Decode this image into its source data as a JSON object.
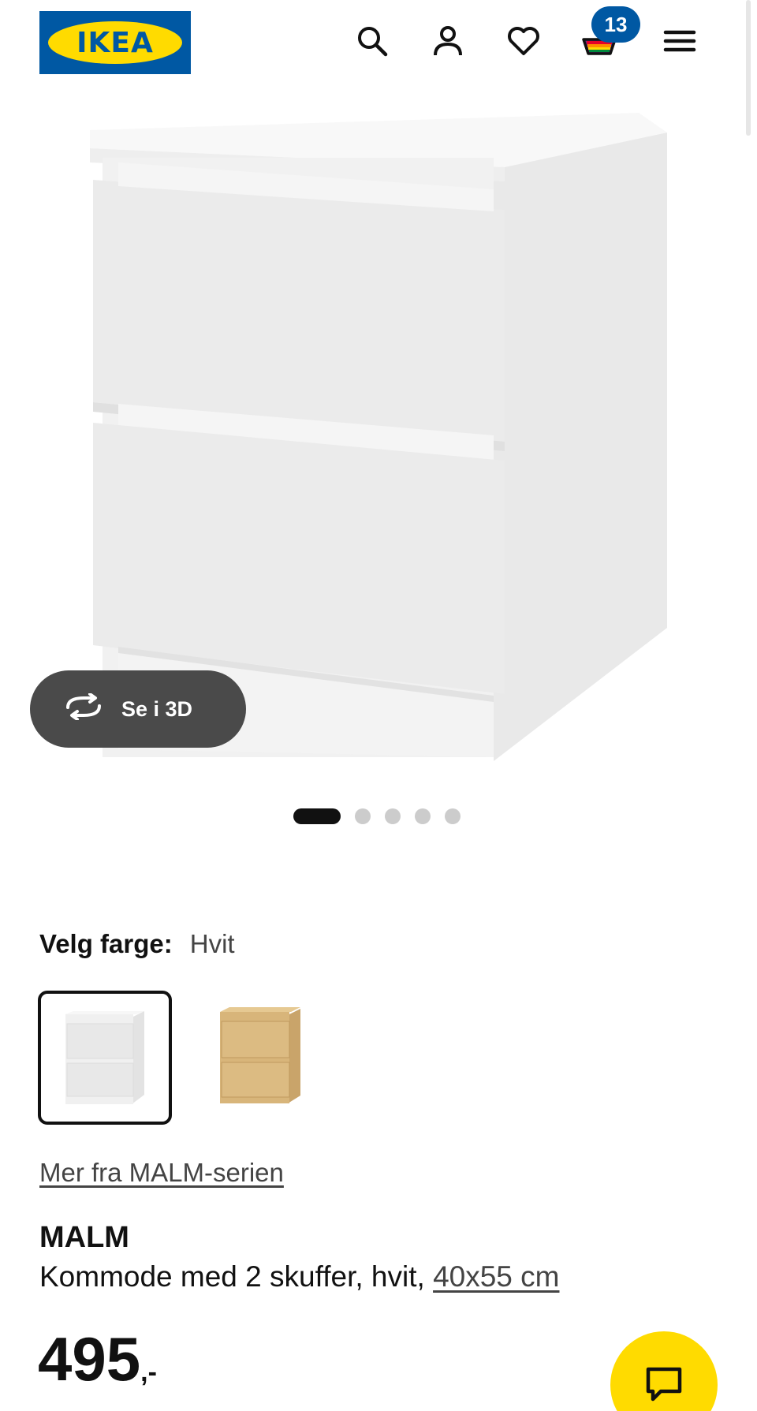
{
  "header": {
    "logo_text": "IKEA",
    "icons": [
      "search-icon",
      "account-icon",
      "heart-icon",
      "cart-icon",
      "menu-icon"
    ],
    "cart_count": "13"
  },
  "gallery": {
    "see_3d_label": "Se i 3D",
    "image_count": 5,
    "active_index": 0
  },
  "color": {
    "label": "Velg farge:",
    "selected_value": "Hvit",
    "options": [
      "white",
      "oak-veneer"
    ]
  },
  "series_link": "Mer fra MALM-serien",
  "product": {
    "name": "MALM",
    "description": "Kommode med 2 skuffer, hvit,",
    "size_link": "40x55 cm",
    "price": "495",
    "price_suffix": ",-"
  },
  "colors": {
    "brand_blue": "#0058a3",
    "brand_yellow": "#ffdb00",
    "dark_button": "#4a4a4a"
  }
}
